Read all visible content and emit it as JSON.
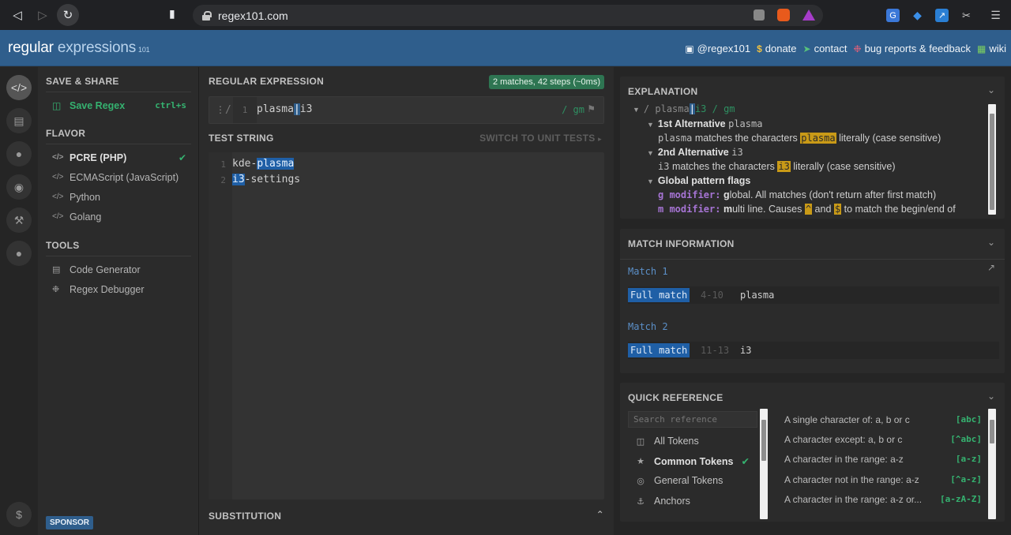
{
  "browser": {
    "url": "regex101.com"
  },
  "header": {
    "brand_main": "regular ",
    "brand_accent": "expressions",
    "brand_version": "101",
    "links": [
      {
        "icon": "twitter-icon",
        "label": "@regex101"
      },
      {
        "icon": "dollar-icon",
        "label": "donate"
      },
      {
        "icon": "paper-plane-icon",
        "label": "contact"
      },
      {
        "icon": "bug-icon",
        "label": "bug reports & feedback"
      },
      {
        "icon": "bank-icon",
        "label": "wiki"
      }
    ]
  },
  "left_panel": {
    "save_share_title": "SAVE & SHARE",
    "save_label": "Save Regex",
    "save_shortcut": "ctrl+s",
    "flavor_title": "FLAVOR",
    "flavors": [
      "PCRE (PHP)",
      "ECMAScript (JavaScript)",
      "Python",
      "Golang"
    ],
    "selected_flavor": "PCRE (PHP)",
    "tools_title": "TOOLS",
    "tools": [
      "Code Generator",
      "Regex Debugger"
    ],
    "sponsor_label": "SPONSOR"
  },
  "regex": {
    "section_title": "REGULAR EXPRESSION",
    "match_badge": "2 matches, 42 steps (~0ms)",
    "line_number": "1",
    "delimiter_open": "/",
    "pattern_left": "plasma",
    "pattern_alt": "|",
    "pattern_right": "i3",
    "flags": "/ gm"
  },
  "test_string": {
    "section_title": "TEST STRING",
    "switch_label": "SWITCH TO UNIT TESTS",
    "lines": [
      {
        "num": "1",
        "pre": "kde-",
        "match": "plasma",
        "post": ""
      },
      {
        "num": "2",
        "pre": "",
        "match": "i3",
        "post": "-settings"
      }
    ]
  },
  "substitution": {
    "section_title": "SUBSTITUTION"
  },
  "explanation": {
    "title": "EXPLANATION",
    "root": "/ plasma|i3 / gm",
    "root_prefix": "/ plasma",
    "root_bar": "|",
    "root_suffix": "i3 / gm",
    "alt1_title": "1st Alternative",
    "alt1_code": "plasma",
    "alt1_text_pre": "matches the characters",
    "alt1_hl": "plasma",
    "alt1_text_post": "literally (case sensitive)",
    "alt2_title": "2nd Alternative",
    "alt2_code": "i3",
    "alt2_text_pre": "matches the characters",
    "alt2_hl": "i3",
    "alt2_text_post": "literally (case sensitive)",
    "flags_title": "Global pattern flags",
    "g_mod": "g modifier:",
    "g_bold": "g",
    "g_text": "lobal. All matches (don't return after first match)",
    "m_mod": "m modifier:",
    "m_bold": "m",
    "m_text_pre": "ulti line. Causes",
    "m_hl1": "^",
    "m_and": "and",
    "m_hl2": "$",
    "m_text_post": "to match the begin/end of"
  },
  "match_info": {
    "title": "MATCH INFORMATION",
    "matches": [
      {
        "label": "Match 1",
        "type": "Full match",
        "range": "4-10",
        "value": "plasma"
      },
      {
        "label": "Match 2",
        "type": "Full match",
        "range": "11-13",
        "value": "i3"
      }
    ]
  },
  "quick_ref": {
    "title": "QUICK REFERENCE",
    "search_placeholder": "Search reference",
    "categories": [
      {
        "icon": "database-icon",
        "label": "All Tokens"
      },
      {
        "icon": "star-icon",
        "label": "Common Tokens"
      },
      {
        "icon": "circle-dot-icon",
        "label": "General Tokens"
      },
      {
        "icon": "anchor-icon",
        "label": "Anchors"
      }
    ],
    "selected_category": "Common Tokens",
    "items": [
      {
        "desc": "A single character of: a, b or c",
        "token": "[abc]"
      },
      {
        "desc": "A character except: a, b or c",
        "token": "[^abc]"
      },
      {
        "desc": "A character in the range: a-z",
        "token": "[a-z]"
      },
      {
        "desc": "A character not in the range: a-z",
        "token": "[^a-z]"
      },
      {
        "desc": "A character in the range: a-z or...",
        "token": "[a-zA-Z]"
      }
    ]
  }
}
